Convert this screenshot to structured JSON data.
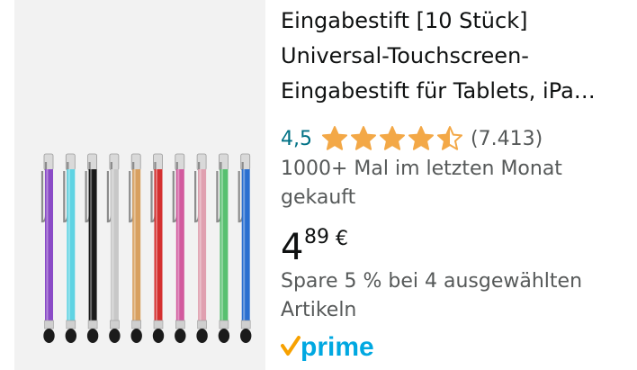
{
  "product": {
    "title": "Eingabestift [10 Stück] Universal-Touchscreen-Eingabestift für Tablets, iPa…",
    "rating": "4,5",
    "rating_stars": 4.5,
    "review_count": "(7.413)",
    "bought_text": "1000+ Mal im letzten Monat gekauft",
    "price": {
      "whole": "4",
      "fraction": "89",
      "currency": "€"
    },
    "savings_text": "Spare 5 % bei 4 ausgewählten Artikeln",
    "prime_label": "prime",
    "image_icon": "stylus-pens-image"
  },
  "colors": {
    "rating_link": "#007185",
    "star": "#f3a847",
    "secondary_text": "#565959",
    "prime_blue": "#00a8e1",
    "prime_check": "#f7a100",
    "image_bg": "#f2f2f2"
  },
  "pen_colors": [
    "#8a4bc7",
    "#5fd3e3",
    "#1a1a1a",
    "#c8c8c8",
    "#d8a060",
    "#d43030",
    "#d25a9e",
    "#e0a0b0",
    "#58c070",
    "#2a6fd0"
  ]
}
